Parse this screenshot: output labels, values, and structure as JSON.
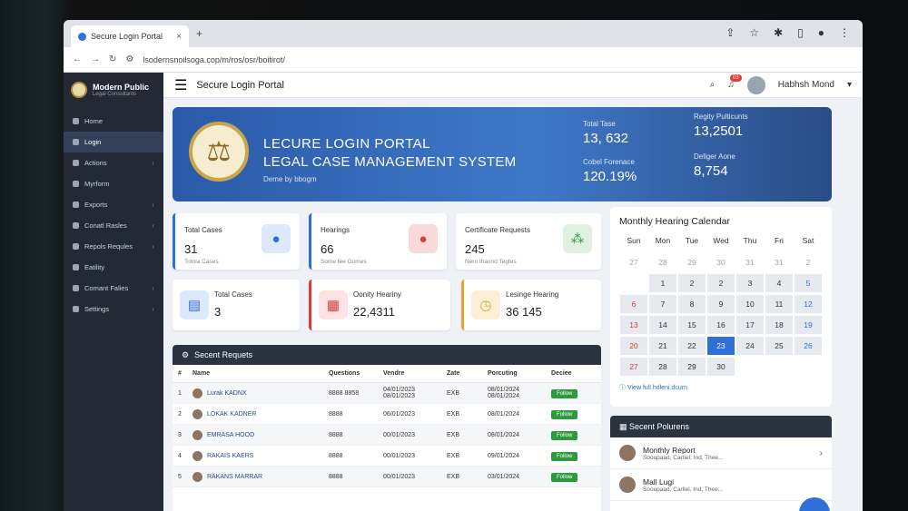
{
  "browser": {
    "tab_title": "Secure Login Portal",
    "url": "lsodernsnoilsoga.cop/m/ros/osr/boitirot/",
    "new_tab": "+"
  },
  "sidebar": {
    "brand_name": "Modern Public",
    "brand_sub": "Legal Consultants",
    "items": [
      {
        "label": "Home"
      },
      {
        "label": "Login"
      },
      {
        "label": "Actions"
      },
      {
        "label": "Myrform"
      },
      {
        "label": "Exports"
      },
      {
        "label": "Conatl Rasles"
      },
      {
        "label": "Repols Requles"
      },
      {
        "label": "Eatility"
      },
      {
        "label": "Comant Falies"
      },
      {
        "label": "Settings"
      }
    ]
  },
  "topbar": {
    "title": "Secure Login Portal",
    "notif_count": "03",
    "user_name": "Habhsh Mond"
  },
  "hero": {
    "line1": "LECURE LOGIN PORTAL",
    "line2": "LEGAL CASE MANAGEMENT SYSTEM",
    "sub": "Deme by bbogm",
    "stats": [
      {
        "label": "Total Tase",
        "value": "13, 632"
      },
      {
        "label": "Cobel Forenace",
        "value": "120.19%"
      },
      {
        "label": "Regity Pulticunts",
        "value": "13,2501"
      },
      {
        "label": "Deliger Aone",
        "value": "8,754"
      }
    ]
  },
  "stats": [
    {
      "label": "Total Cases",
      "value": "31",
      "sub": "Totnia Cases"
    },
    {
      "label": "Hearings",
      "value": "66",
      "sub": "Some fee Gomes"
    },
    {
      "label": "Certificate Requests",
      "value": "245",
      "sub": "Nero Ihaond Tegtes"
    },
    {
      "label": "Total Cases",
      "value": "3",
      "sub": ""
    },
    {
      "label": "Oonity Heariny",
      "value": "22,4311",
      "sub": ""
    },
    {
      "label": "Lesinge Hearing",
      "value": "36 145",
      "sub": ""
    }
  ],
  "requests": {
    "title": "Secent Requets",
    "columns": [
      "#",
      "Name",
      "Questions",
      "Vendre",
      "Zate",
      "Porcuting",
      "Deciee"
    ],
    "rows": [
      {
        "n": "1",
        "name": "Lurak KADNX",
        "q": "8888\n8858",
        "v": "04/01/2023\n08/01/2023",
        "z": "EXB",
        "p": "08/01/2024\n08/01/2024",
        "action": "Follow"
      },
      {
        "n": "2",
        "name": "LOKAK KADNER",
        "q": "8888",
        "v": "06/01/2023",
        "z": "EXB",
        "p": "08/01/2024",
        "action": "Follow"
      },
      {
        "n": "3",
        "name": "EMRASA HOOD",
        "q": "8888",
        "v": "00/01/2023",
        "z": "EXB",
        "p": "08/01/2024",
        "action": "Follow"
      },
      {
        "n": "4",
        "name": "RAKAIS KAERS",
        "q": "8888",
        "v": "00/01/2023",
        "z": "EXB",
        "p": "09/01/2024",
        "action": "Follow"
      },
      {
        "n": "5",
        "name": "RAKANS MARRAR",
        "q": "8888",
        "v": "00/01/2023",
        "z": "EXB",
        "p": "03/01/2024",
        "action": "Follow"
      }
    ]
  },
  "calendar": {
    "title": "Monthly Hearing Calendar",
    "days": [
      "Sun",
      "Mon",
      "Tue",
      "Wed",
      "Thu",
      "Fri",
      "Sat"
    ],
    "cells": [
      [
        "27",
        "muted"
      ],
      [
        "28",
        "muted"
      ],
      [
        "29",
        "muted"
      ],
      [
        "30",
        "muted"
      ],
      [
        "31",
        "muted"
      ],
      [
        "31",
        "muted"
      ],
      [
        "2",
        "muted"
      ],
      [
        "",
        ""
      ],
      [
        "1",
        ""
      ],
      [
        "2",
        ""
      ],
      [
        "2",
        ""
      ],
      [
        "3",
        ""
      ],
      [
        "4",
        ""
      ],
      [
        "5",
        "blue"
      ],
      [
        "6",
        "red"
      ],
      [
        "7",
        ""
      ],
      [
        "8",
        ""
      ],
      [
        "9",
        ""
      ],
      [
        "10",
        ""
      ],
      [
        "11",
        ""
      ],
      [
        "12",
        "blue"
      ],
      [
        "13",
        "red"
      ],
      [
        "14",
        ""
      ],
      [
        "15",
        ""
      ],
      [
        "16",
        ""
      ],
      [
        "17",
        ""
      ],
      [
        "18",
        ""
      ],
      [
        "19",
        "blue"
      ],
      [
        "20",
        "red"
      ],
      [
        "21",
        ""
      ],
      [
        "22",
        ""
      ],
      [
        "23",
        "today"
      ],
      [
        "24",
        ""
      ],
      [
        "25",
        ""
      ],
      [
        "26",
        "blue"
      ],
      [
        "27",
        "red"
      ],
      [
        "28",
        ""
      ],
      [
        "29",
        ""
      ],
      [
        "30",
        ""
      ],
      [
        "",
        ""
      ],
      [
        "",
        ""
      ],
      [
        "",
        ""
      ]
    ],
    "link": "View full hdleni.dcurn"
  },
  "recent": {
    "title": "Secent Polurens",
    "items": [
      {
        "title": "Monthly Report",
        "sub": "Sooupaad, Cartiel, Ind, Thee..."
      },
      {
        "title": "Mall Lugi",
        "sub": "Sooupaad, Carllel, Ind, Thee..."
      }
    ]
  }
}
